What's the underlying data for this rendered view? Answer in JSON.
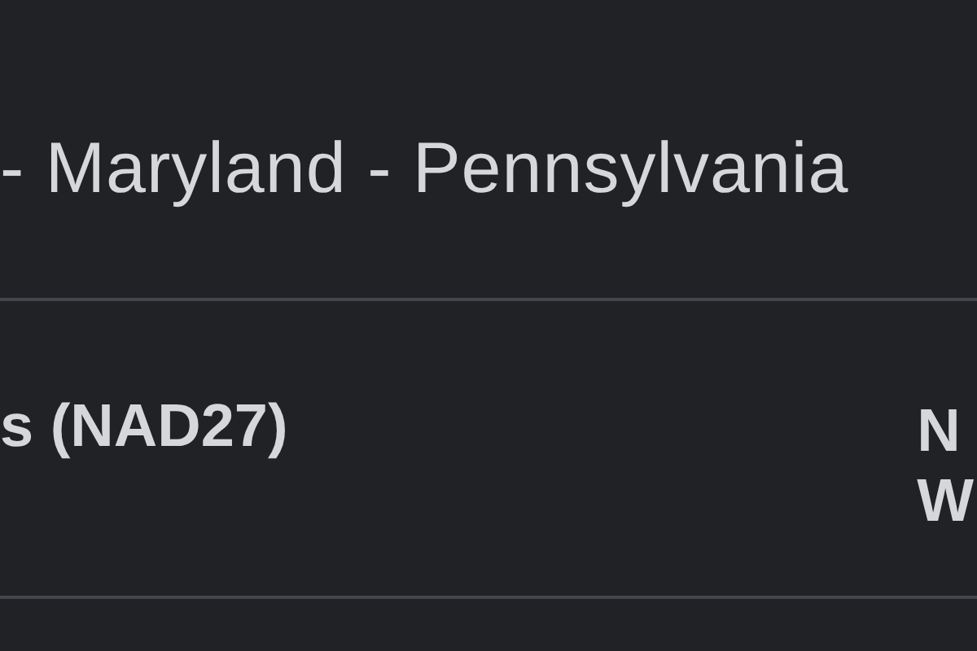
{
  "title": "- Maryland - Pennsylvania",
  "rows": [
    {
      "label": "s (NAD27)",
      "value_lines": [
        "N",
        "W"
      ]
    }
  ]
}
